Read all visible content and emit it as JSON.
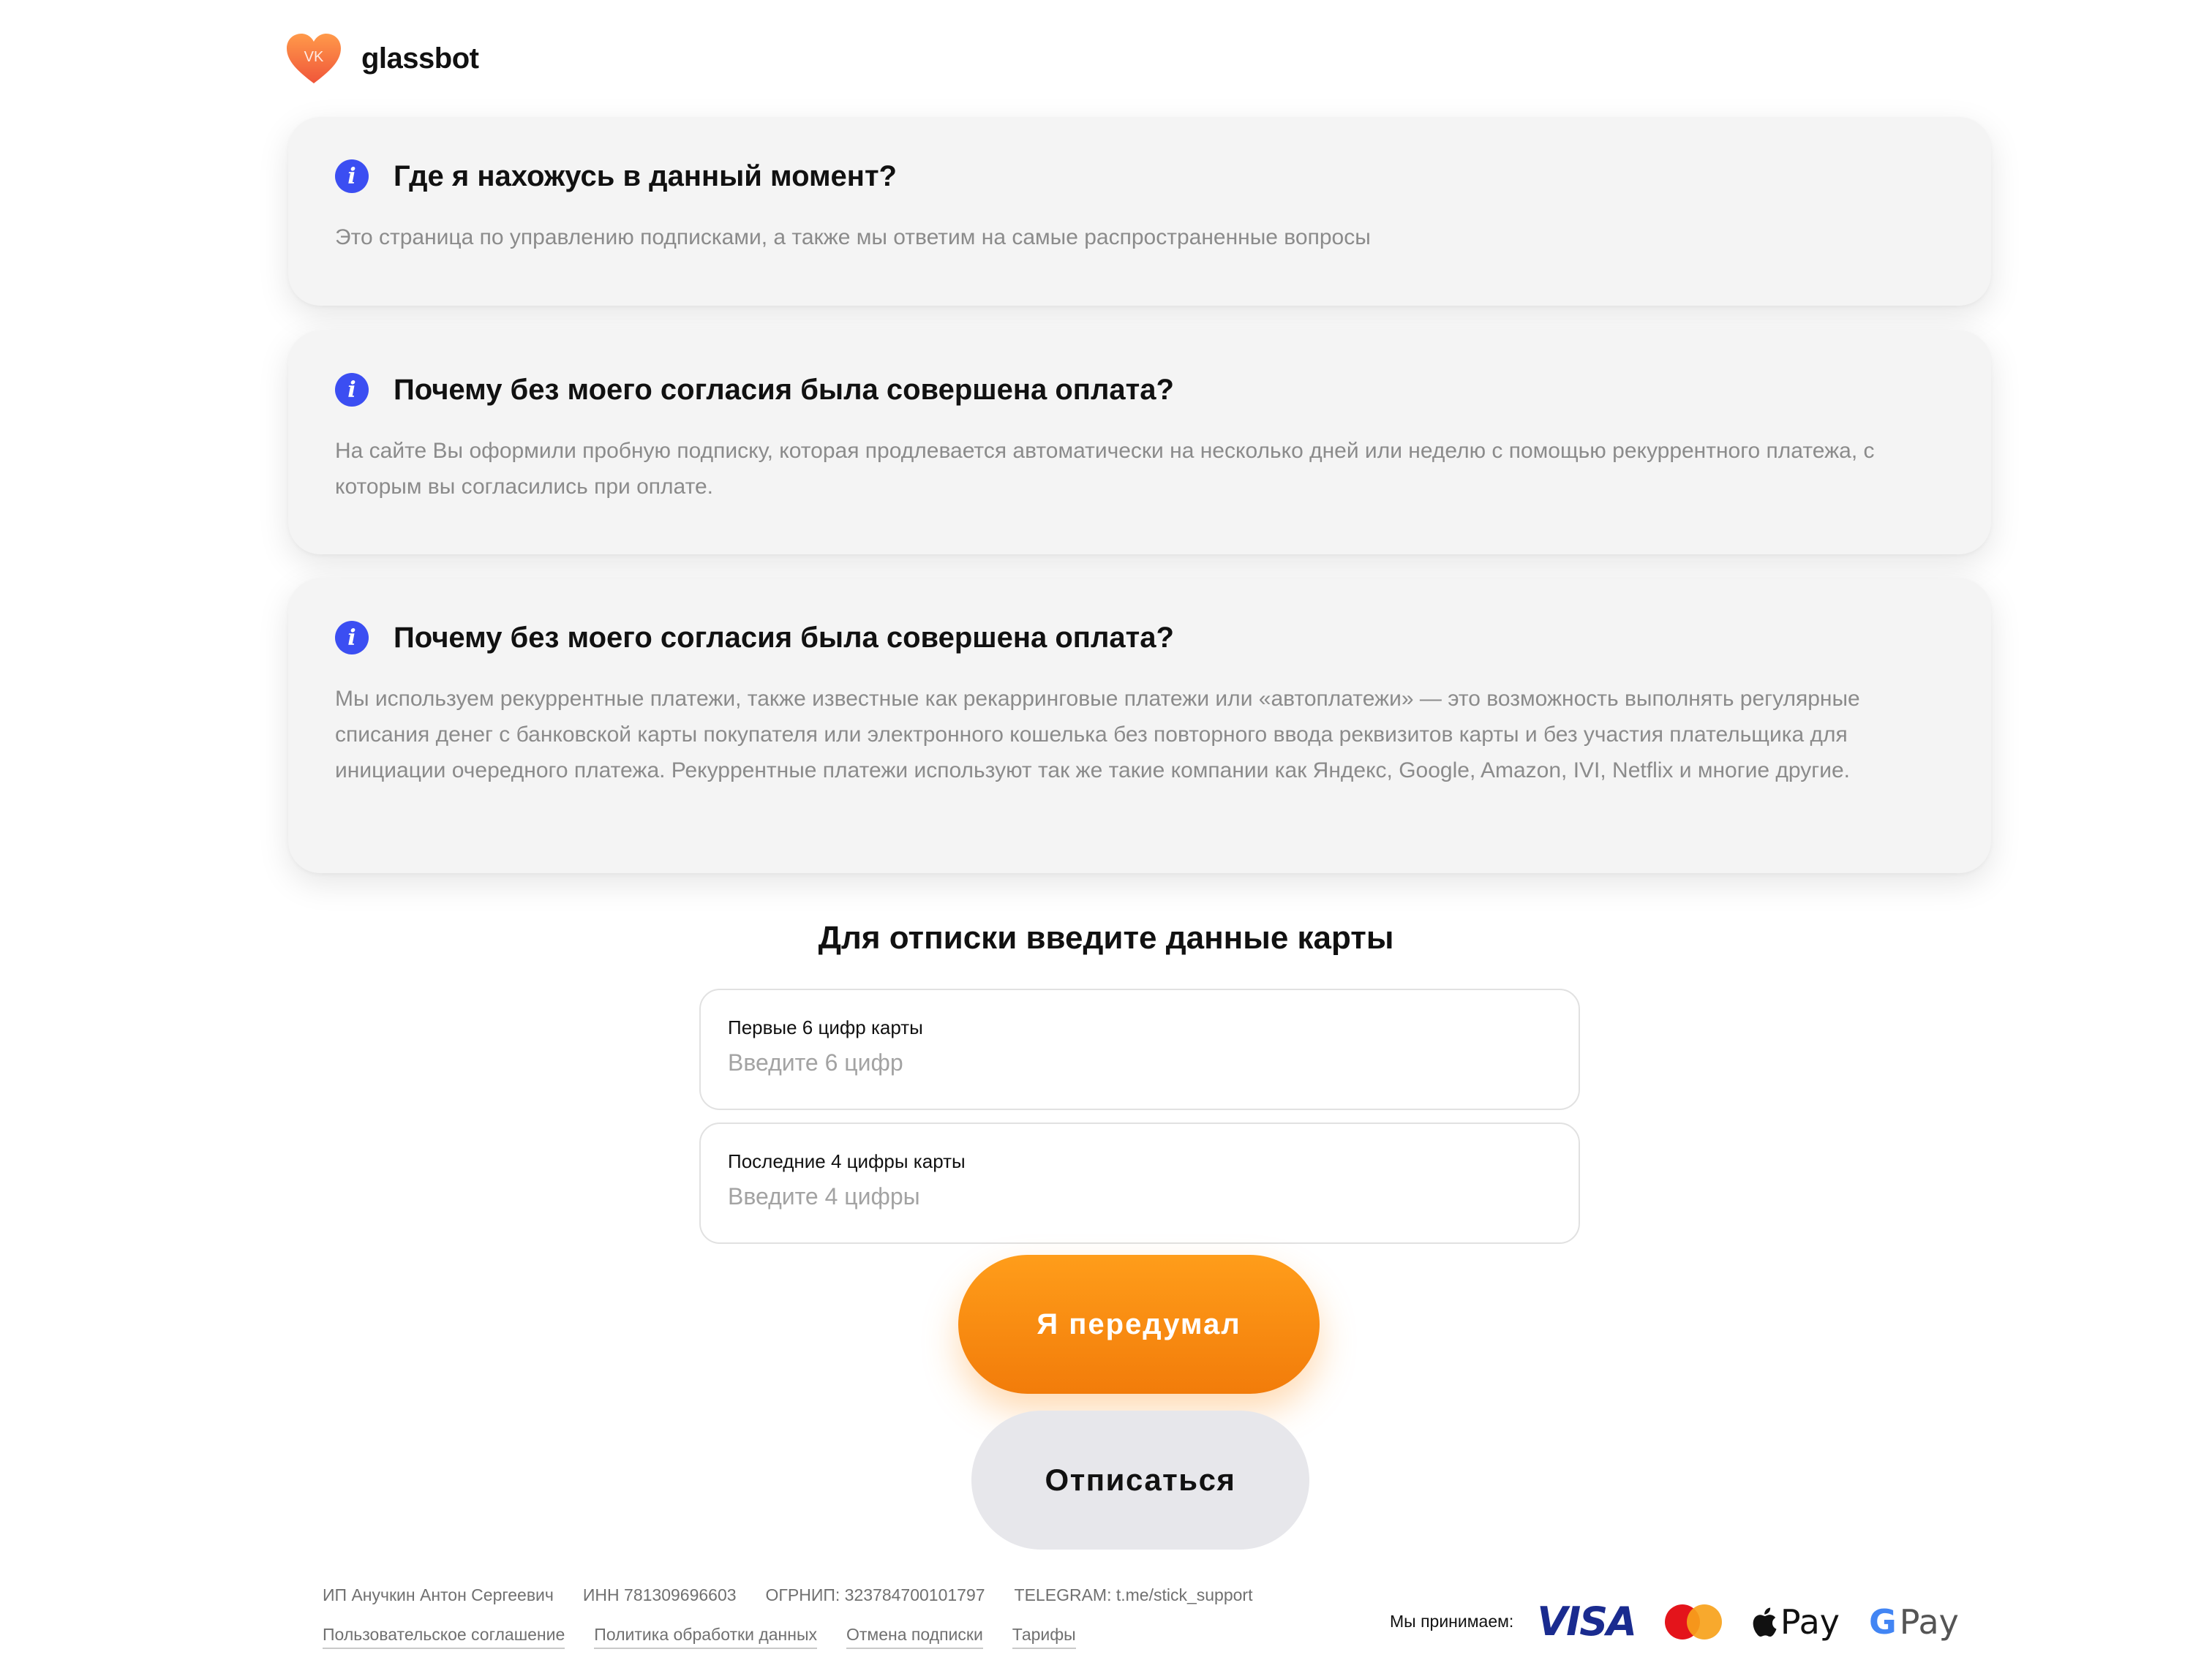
{
  "app": {
    "brand": "glassbot",
    "logo_badge": "VK",
    "accent_color": "#ff8a15",
    "info_icon_color": "#3b4ef2"
  },
  "faq": [
    {
      "icon": "info-icon",
      "title": "Где я нахожусь в данный момент?",
      "text": "Это страница по управлению подписками, а также мы ответим на самые распространенные вопросы"
    },
    {
      "icon": "info-icon",
      "title": "Почему без моего согласия была совершена оплата?",
      "text": "На сайте Вы оформили пробную подписку, которая продлевается автоматически на несколько дней или неделю с помощью рекуррентного платежа, с которым вы согласились при оплате."
    },
    {
      "icon": "info-icon",
      "title": "Почему без моего согласия была совершена оплата?",
      "text": "Мы используем рекуррентные платежи, также известные как рекарринговые платежи или «автоплатежи» — это возможность выполнять регулярные списания денег с банковской карты покупателя или электронного кошелька без повторного ввода реквизитов карты и без участия плательщика для инициации очередного платежа. Рекуррентные платежи используют так же такие компании как Яндекс, Google, Amazon, IVI, Netflix и многие другие."
    }
  ],
  "form": {
    "title": "Для отписки введите данные карты",
    "first_digits": {
      "label": "Первые 6 цифр карты",
      "placeholder": "Введите 6 цифр",
      "value": ""
    },
    "last_digits": {
      "label": "Последние 4 цифры карты",
      "placeholder": "Введите 4 цифры",
      "value": ""
    },
    "primary_button": "Я передумал",
    "secondary_button": "Отписаться"
  },
  "footer": {
    "info": [
      "ИП Анучкин Антон Сергеевич",
      "ИНН 781309696603",
      "ОГРНИП: 323784700101797",
      "TELEGRAM: t.me/stick_support"
    ],
    "links": [
      "Пользовательское соглашение",
      "Политика обработки данных",
      "Отмена подписки",
      "Тарифы"
    ],
    "accept_label": "Мы принимаем:",
    "payment": {
      "visa": "VISA",
      "mastercard_text": "MasterCard",
      "apple_pay": "Pay",
      "google_pay": "Pay",
      "google_g": "G"
    }
  }
}
